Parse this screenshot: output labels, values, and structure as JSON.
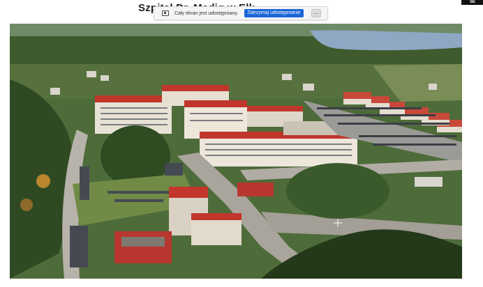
{
  "slide": {
    "title": "Szpital Dr. Mediq w Ełk",
    "corner_badge": "SE"
  },
  "share_bar": {
    "icon": "screen-share-icon",
    "status_text": "Cały ekran jest udostępniany.",
    "stop_label": "Zatrzymaj udostępnianie",
    "more_label": "..."
  },
  "video": {
    "description_icon": "aerial-photo",
    "cursor_icon": "crosshair-cursor-icon"
  }
}
